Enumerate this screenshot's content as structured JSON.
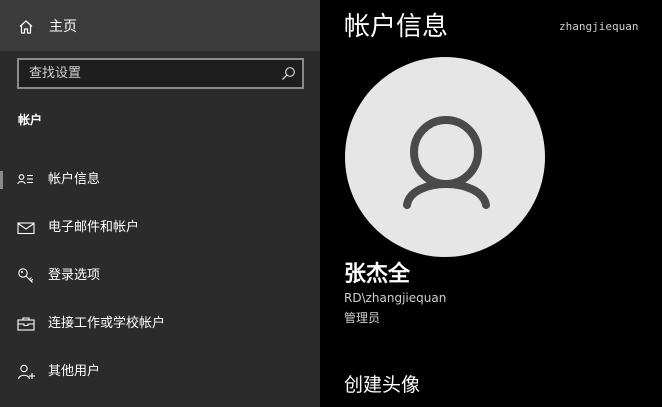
{
  "sidebar": {
    "home_label": "主页",
    "search_placeholder": "查找设置",
    "section_title": "帐户",
    "items": [
      {
        "label": "帐户信息",
        "icon": "person-list-icon",
        "selected": true
      },
      {
        "label": "电子邮件和帐户",
        "icon": "mail-icon",
        "selected": false
      },
      {
        "label": "登录选项",
        "icon": "key-icon",
        "selected": false
      },
      {
        "label": "连接工作或学校帐户",
        "icon": "briefcase-icon",
        "selected": false
      },
      {
        "label": "其他用户",
        "icon": "add-person-icon",
        "selected": false
      }
    ]
  },
  "main": {
    "title": "帐户信息",
    "top_username": "zhangjiequan",
    "display_name": "张杰全",
    "account_id": "RD\\zhangjiequan",
    "role": "管理员",
    "section_heading": "创建头像"
  },
  "colors": {
    "sidebar_bg": "#2b2b2b",
    "home_bg": "#3c3c3c",
    "main_bg": "#000000",
    "avatar_bg": "#e6e6e6",
    "avatar_fg": "#4a4a4a"
  }
}
